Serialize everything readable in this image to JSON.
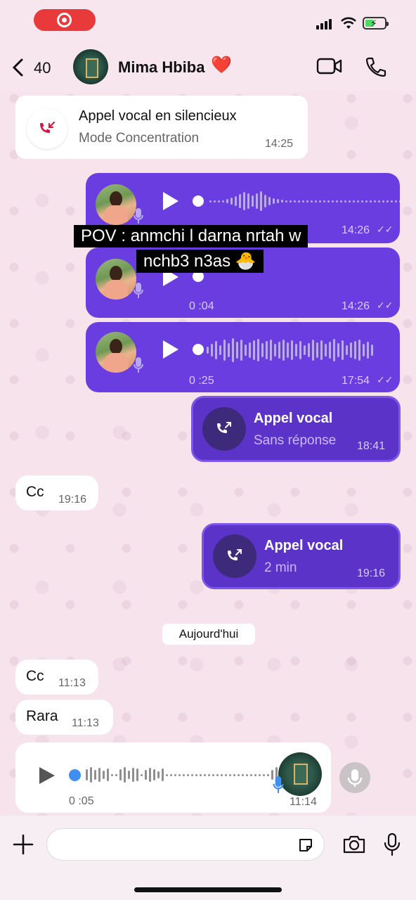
{
  "status_bar": {
    "wifi_icon": "wifi-icon",
    "battery_icon": "battery-charging-icon"
  },
  "header": {
    "back_count": "40",
    "contact_name": "Mima Hbiba",
    "heart": "❤️"
  },
  "overlay": {
    "line1": "POV : anmchi l darna nrtah w",
    "line2": "nchb3 n3as 🐣"
  },
  "messages": {
    "missed": {
      "title": "Appel vocal en silencieux",
      "subtitle": "Mode Concentration",
      "time": "14:25"
    },
    "voice1": {
      "time": "14:26"
    },
    "voice2": {
      "duration": "0 :04",
      "time": "14:26"
    },
    "voice3": {
      "duration": "0 :25",
      "time": "17:54"
    },
    "call1": {
      "title": "Appel vocal",
      "subtitle": "Sans réponse",
      "time": "18:41"
    },
    "cc1": {
      "text": "Cc",
      "time": "19:16"
    },
    "call2": {
      "title": "Appel vocal",
      "subtitle": "2 min",
      "time": "19:16"
    },
    "date_chip": "Aujourd'hui",
    "cc2": {
      "text": "Cc",
      "time": "11:13"
    },
    "rara": {
      "text": "Rara",
      "time": "11:13"
    },
    "voice_in": {
      "duration": "0 :05",
      "time": "11:14"
    }
  },
  "composer": {
    "placeholder": ""
  }
}
